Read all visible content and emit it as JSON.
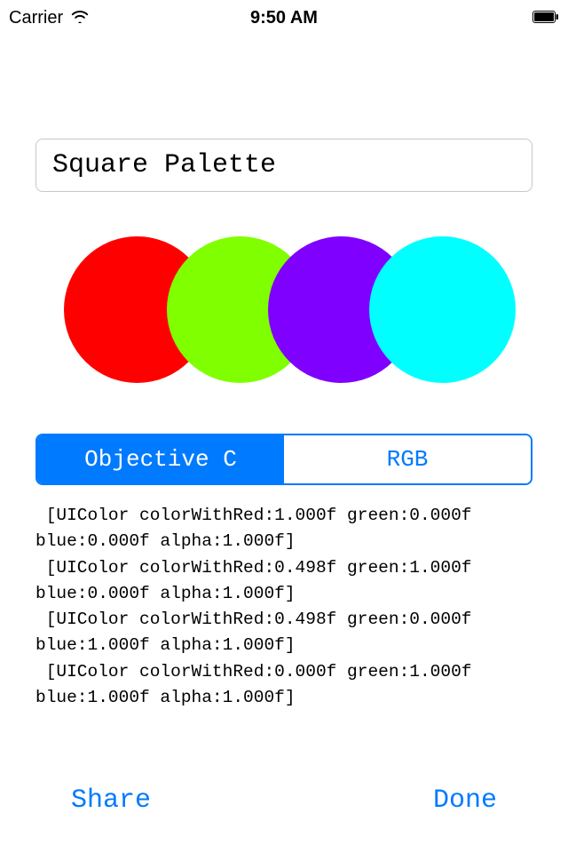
{
  "status_bar": {
    "carrier": "Carrier",
    "time": "9:50 AM"
  },
  "title_field": {
    "value": "Square Palette"
  },
  "palette": {
    "colors": [
      "#ff0000",
      "#80ff00",
      "#8000ff",
      "#00ffff"
    ]
  },
  "segmented": {
    "options": [
      "Objective C",
      "RGB"
    ],
    "selected_index": 0
  },
  "code_output": " [UIColor colorWithRed:1.000f green:0.000f blue:0.000f alpha:1.000f]\n [UIColor colorWithRed:0.498f green:1.000f blue:0.000f alpha:1.000f]\n [UIColor colorWithRed:0.498f green:0.000f blue:1.000f alpha:1.000f]\n [UIColor colorWithRed:0.000f green:1.000f blue:1.000f alpha:1.000f]",
  "bottom_bar": {
    "share": "Share",
    "done": "Done"
  },
  "accent_color": "#007aff"
}
